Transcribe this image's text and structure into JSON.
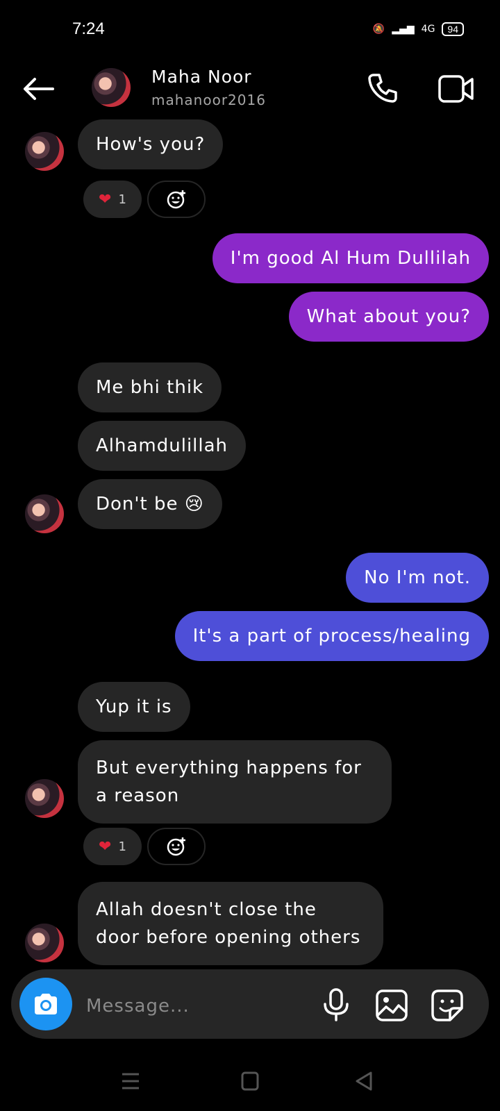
{
  "status_bar": {
    "time": "7:24",
    "battery": "94",
    "network": "4G"
  },
  "header": {
    "name": "Maha Noor",
    "username": "mahanoor2016"
  },
  "messages": {
    "m1": "How's you?",
    "m2": "I'm good Al Hum Dullilah",
    "m3": "What about you?",
    "m4": "Me bhi thik",
    "m5": "Alhamdulillah",
    "m6": "Don't be 😢",
    "m7": "No I'm not.",
    "m8": "It's a part of process/healing",
    "m9": "Yup it is",
    "m10": "But everything happens for a reason",
    "m11": "Allah doesn't close the door before opening others"
  },
  "reactions": {
    "r1_count": "1",
    "r2_count": "1"
  },
  "composer": {
    "placeholder": "Message..."
  },
  "colors": {
    "received_bubble": "#262626",
    "sent_purple": "#8b29c9",
    "sent_blue": "#4e4fd8",
    "camera_button": "#1c93f2"
  },
  "icons": [
    "back-arrow-icon",
    "phone-icon",
    "video-icon",
    "camera-icon",
    "mic-icon",
    "gallery-icon",
    "sticker-icon",
    "heart-icon",
    "add-reaction-icon",
    "menu-icon",
    "home-icon",
    "back-triangle-icon"
  ]
}
